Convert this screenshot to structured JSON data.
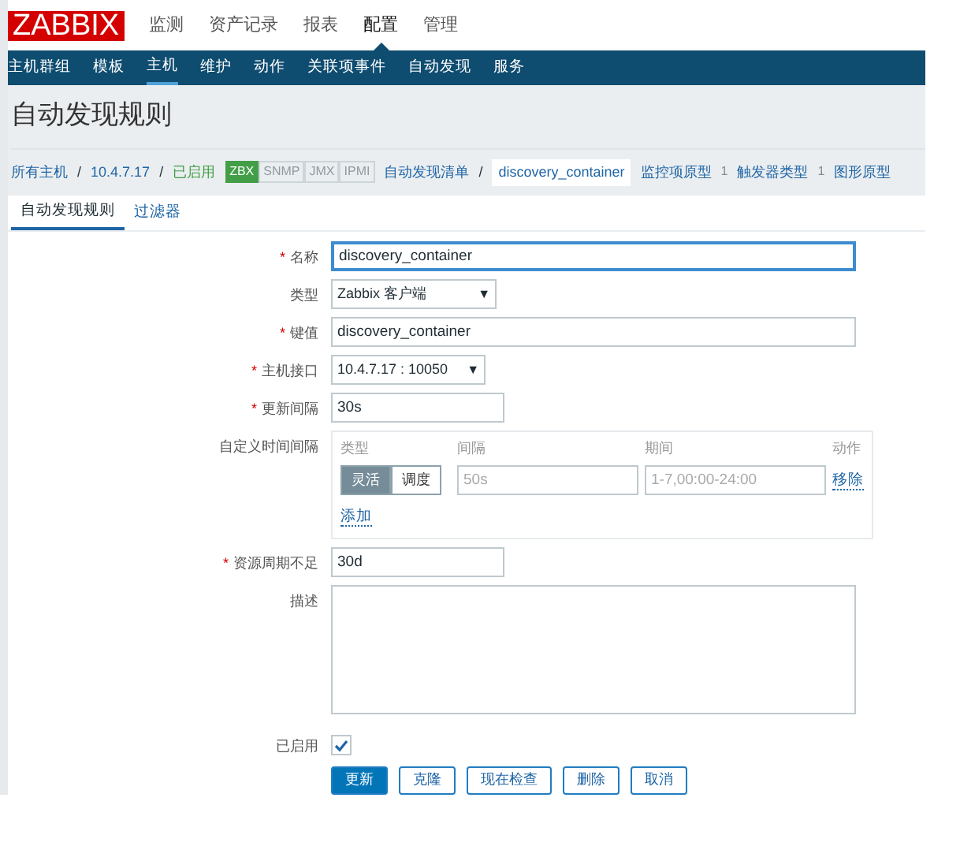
{
  "logo": "ZABBIX",
  "main_menu": [
    {
      "label": "监测",
      "selected": false
    },
    {
      "label": "资产记录",
      "selected": false
    },
    {
      "label": "报表",
      "selected": false
    },
    {
      "label": "配置",
      "selected": true
    },
    {
      "label": "管理",
      "selected": false
    }
  ],
  "sub_menu": [
    {
      "label": "主机群组",
      "selected": false
    },
    {
      "label": "模板",
      "selected": false
    },
    {
      "label": "主机",
      "selected": true
    },
    {
      "label": "维护",
      "selected": false
    },
    {
      "label": "动作",
      "selected": false
    },
    {
      "label": "关联项事件",
      "selected": false
    },
    {
      "label": "自动发现",
      "selected": false
    },
    {
      "label": "服务",
      "selected": false
    }
  ],
  "page_title": "自动发现规则",
  "breadcrumb": {
    "separator": "/",
    "hosts": [
      "所有主机",
      "10.4.7.17"
    ],
    "status": "已启用",
    "interfaces": [
      {
        "label": "ZBX",
        "active": true
      },
      {
        "label": "SNMP",
        "active": false
      },
      {
        "label": "JMX",
        "active": false
      },
      {
        "label": "IPMI",
        "active": false
      }
    ],
    "discovery_list": "自动发现清单",
    "current": "discovery_container",
    "related": [
      {
        "label": "监控项原型",
        "count": "1"
      },
      {
        "label": "触发器类型",
        "count": "1"
      },
      {
        "label": "图形原型"
      }
    ]
  },
  "tabs": [
    {
      "label": "自动发现规则",
      "selected": true
    },
    {
      "label": "过滤器",
      "selected": false
    }
  ],
  "fields": [
    {
      "kind": "text",
      "label": "名称",
      "required_mark": "*",
      "value": "discovery_container",
      "focused": true,
      "wide": true
    },
    {
      "kind": "select",
      "label": "类型",
      "value": "Zabbix 客户端",
      "caret": "▼"
    },
    {
      "kind": "text",
      "label": "键值",
      "required_mark": "*",
      "value": "discovery_container",
      "focused": false,
      "wide": true
    },
    {
      "kind": "select",
      "label": "主机接口",
      "required_mark": "*",
      "value": "10.4.7.17 : 10050",
      "caret": "▼"
    },
    {
      "kind": "text",
      "label": "更新间隔",
      "required_mark": "*",
      "value": "30s",
      "focused": false,
      "wide": false
    },
    {
      "kind": "interval",
      "label": "自定义时间间隔",
      "columns": [
        "类型",
        "间隔",
        "期间",
        "动作"
      ],
      "rows": [
        {
          "types": [
            {
              "label": "灵活",
              "selected": true
            },
            {
              "label": "调度",
              "selected": false
            }
          ],
          "interval_placeholder": "50s",
          "period_placeholder": "1-7,00:00-24:00",
          "action": "移除"
        }
      ],
      "add": "添加"
    },
    {
      "kind": "text",
      "label": "资源周期不足",
      "required_mark": "*",
      "value": "30d",
      "focused": false,
      "wide": false
    },
    {
      "kind": "textarea",
      "label": "描述"
    },
    {
      "kind": "checkbox",
      "label": "已启用",
      "checked": true
    }
  ],
  "buttons": [
    {
      "label": "更新",
      "primary": true
    },
    {
      "label": "克隆",
      "primary": false
    },
    {
      "label": "现在检查",
      "primary": false
    },
    {
      "label": "删除",
      "primary": false
    },
    {
      "label": "取消",
      "primary": false
    }
  ]
}
